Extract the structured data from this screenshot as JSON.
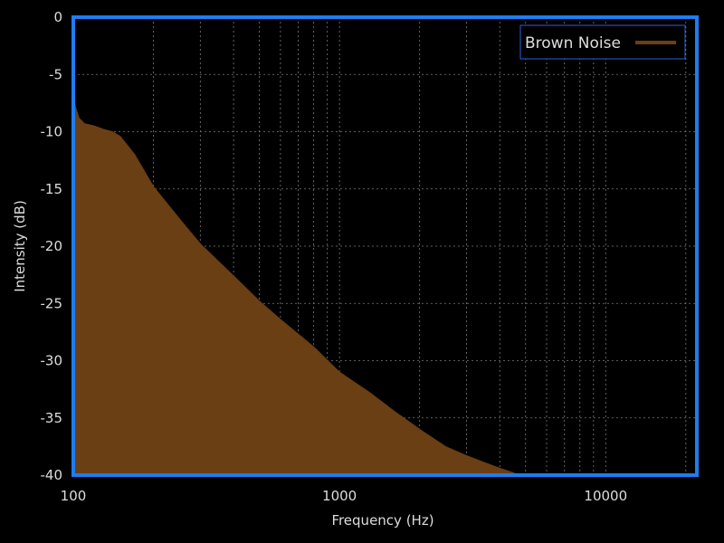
{
  "colors": {
    "background": "#000000",
    "frame": "#1e7df0",
    "grid": "#7a7a7a",
    "fill": "#6b3f14",
    "text": "#dcdcdc",
    "legend_border": "#2a5fd8"
  },
  "chart_data": {
    "type": "area",
    "xlabel": "Frequency (Hz)",
    "ylabel": "Intensity (dB)",
    "x_scale": "log",
    "xlim": [
      100,
      22000
    ],
    "ylim": [
      -40,
      0
    ],
    "x_ticks": [
      100,
      1000,
      10000
    ],
    "x_tick_labels": [
      "100",
      "1000",
      "10000"
    ],
    "y_ticks": [
      0,
      -5,
      -10,
      -15,
      -20,
      -25,
      -30,
      -35,
      -40
    ],
    "y_tick_labels": [
      "0",
      "-5",
      "-10",
      "-15",
      "-20",
      "-25",
      "-30",
      "-35",
      "-40"
    ],
    "grid": true,
    "legend_position": "top-right",
    "series": [
      {
        "name": "Brown Noise",
        "color": "#6b3f14",
        "x": [
          100,
          105,
          110,
          120,
          130,
          140,
          150,
          170,
          200,
          250,
          300,
          400,
          500,
          600,
          800,
          1000,
          1300,
          1600,
          2000,
          2500,
          3000,
          3500,
          4000,
          4500,
          4700
        ],
        "y": [
          -7.2,
          -8.8,
          -9.3,
          -9.5,
          -9.8,
          -10.0,
          -10.4,
          -12.0,
          -14.8,
          -17.6,
          -19.8,
          -22.6,
          -24.8,
          -26.4,
          -28.8,
          -31.0,
          -32.8,
          -34.4,
          -36.0,
          -37.5,
          -38.3,
          -38.9,
          -39.4,
          -39.8,
          -40.0
        ]
      }
    ]
  }
}
